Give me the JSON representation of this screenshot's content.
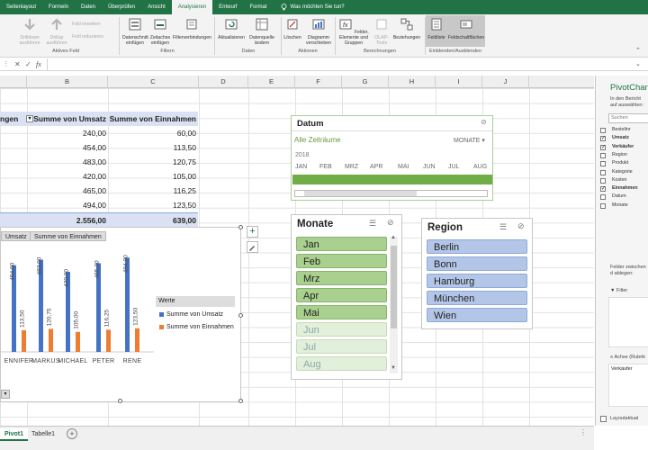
{
  "ribbon_tabs": [
    "Seitenlayout",
    "Formeln",
    "Daten",
    "Überprüfen",
    "Ansicht",
    "Analysieren",
    "Entwurf",
    "Format"
  ],
  "active_tab": "Analysieren",
  "tell_me": "Was möchten Sie tun?",
  "ribbon": {
    "groups": {
      "active_field": "Aktives Feld",
      "filter": "Filtern",
      "data": "Daten",
      "actions": "Aktionen",
      "calc": "Berechnungen",
      "show": "Einblenden/Ausblenden"
    },
    "buttons": {
      "drill_down": "Drilldown ausführen",
      "drill_up": "Drillup ausführen",
      "expand_field": "Feld erweitern",
      "collapse_field": "Feld reduzieren",
      "insert_slicer": "Datenschnitt einfügen",
      "insert_timeline": "Zeitachse einfügen",
      "filter_conn": "Filterverbindungen",
      "refresh": "Aktualisieren",
      "change_source": "Datenquelle ändern",
      "clear": "Löschen",
      "move_chart": "Diagramm verschieben",
      "fields_items": "Felder, Elemente und Gruppen",
      "olap": "OLAP-Tools",
      "relationships": "Beziehungen",
      "field_list": "Feldliste",
      "field_buttons": "Feldschaltflächen"
    }
  },
  "formula_bar": {
    "fx": "fx"
  },
  "columns": [
    "B",
    "C",
    "D",
    "E",
    "F",
    "G",
    "H",
    "I",
    "J"
  ],
  "pivot": {
    "headers": [
      "ngen",
      "Summe von Umsatz",
      "Summe von Einnahmen"
    ],
    "rows": [
      [
        "240,00",
        "60,00"
      ],
      [
        "454,00",
        "113,50"
      ],
      [
        "483,00",
        "120,75"
      ],
      [
        "420,00",
        "105,00"
      ],
      [
        "465,00",
        "116,25"
      ],
      [
        "494,00",
        "123,50"
      ]
    ],
    "total": [
      "2.556,00",
      "639,00"
    ]
  },
  "chart": {
    "buttons": [
      "Umsatz",
      "Summe von Einnahmen"
    ],
    "legend_title": "Werte",
    "legend": [
      "Summe von Umsatz",
      "Summe von Einnahmen"
    ],
    "categories": [
      "ENNIFER",
      "MARKUS",
      "MICHAEL",
      "PETER",
      "RENE"
    ],
    "umsatz": [
      454,
      483,
      420,
      465,
      494
    ],
    "einnahmen": [
      113.5,
      120.75,
      105,
      116.25,
      123.5
    ],
    "umsatz_labels": [
      "454,00",
      "483,00",
      "420,00",
      "465,00",
      "494,00"
    ],
    "einnahmen_labels": [
      "113,50",
      "120,75",
      "105,00",
      "116,25",
      "123,50"
    ],
    "colors": {
      "umsatz": "#4472c4",
      "einnahmen": "#ed7d31"
    }
  },
  "timeline": {
    "title": "Datum",
    "all_periods": "Alle Zeiträume",
    "level": "MONATE",
    "year": "2018",
    "months": [
      "JAN",
      "FEB",
      "MRZ",
      "APR",
      "MAI",
      "JUN",
      "JUL",
      "AUG"
    ]
  },
  "slicer_monate": {
    "title": "Monate",
    "items": [
      "Jan",
      "Feb",
      "Mrz",
      "Apr",
      "Mai",
      "Jun",
      "Jul",
      "Aug"
    ],
    "selected_count": 5
  },
  "slicer_region": {
    "title": "Region",
    "items": [
      "Berlin",
      "Bonn",
      "Hamburg",
      "München",
      "Wien"
    ]
  },
  "side_panel": {
    "title": "PivotChart",
    "subtitle": "In den Bericht auf auswählen:",
    "search": "Suchen",
    "fields": [
      {
        "label": "Bestellnr",
        "checked": false
      },
      {
        "label": "Umsatz",
        "checked": true
      },
      {
        "label": "Verkäufer",
        "checked": true
      },
      {
        "label": "Region",
        "checked": false
      },
      {
        "label": "Produkt",
        "checked": false
      },
      {
        "label": "Kategorie",
        "checked": false
      },
      {
        "label": "Kosten",
        "checked": false
      },
      {
        "label": "Einnahmen",
        "checked": true
      },
      {
        "label": "Datum",
        "checked": false
      },
      {
        "label": "Monate",
        "checked": false
      }
    ],
    "drag_hint": "Felder zwischen d ablegen:",
    "filter": "Filter",
    "axis": "Achse (Rubrik",
    "axis_item": "Verkäufer",
    "layout_defer": "Layoutaktual"
  },
  "sheets": {
    "tabs": [
      "Pivot1",
      "Tabelle1"
    ],
    "active": "Pivot1",
    "add": "+"
  }
}
